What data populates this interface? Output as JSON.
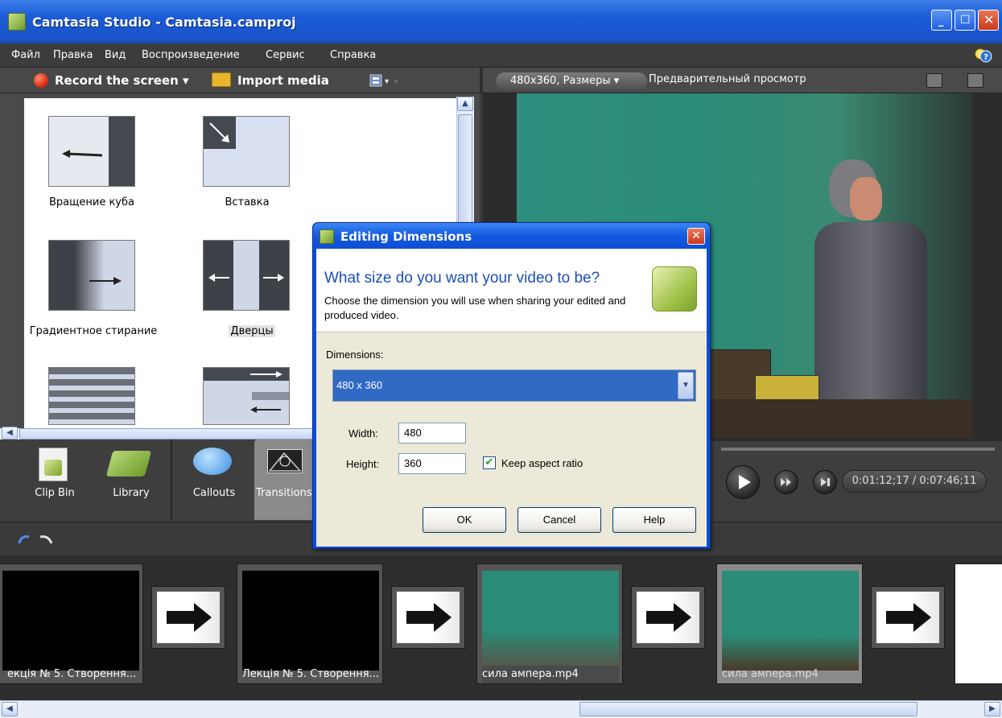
{
  "window": {
    "title": "Camtasia Studio - Camtasia.camproj"
  },
  "menu": [
    "Файл",
    "Правка",
    "Вид",
    "Воспроизведение",
    "Сервис",
    "Справка"
  ],
  "toolbar": {
    "record_label": "Record the screen",
    "import_label": "Import media"
  },
  "transitions": [
    {
      "label": "Вращение куба"
    },
    {
      "label": "Вставка"
    },
    {
      "label": "Градиентное стирание"
    },
    {
      "label": "Дверцы"
    }
  ],
  "tabs": [
    "Clip Bin",
    "Library",
    "Callouts",
    "Transitions"
  ],
  "preview": {
    "size_label": "480x360, Размеры",
    "title": "Предварительный просмотр",
    "time": "0:01:12;17 / 0:07:46;11"
  },
  "storyboard": [
    {
      "caption": "екція № 5. Створення..."
    },
    {
      "caption": "Лекція № 5. Створення..."
    },
    {
      "caption": "сила ампера.mp4"
    },
    {
      "caption": "сила ампера.mp4"
    }
  ],
  "dialog": {
    "title": "Editing Dimensions",
    "question": "What size do you want your video to be?",
    "description": "Choose the dimension you will use when sharing your edited and produced video.",
    "dimensions_label": "Dimensions:",
    "dimensions_value": "480 x 360",
    "width_label": "Width:",
    "width_value": "480",
    "height_label": "Height:",
    "height_value": "360",
    "keep_aspect_label": "Keep aspect ratio",
    "keep_aspect_checked": true,
    "ok": "OK",
    "cancel": "Cancel",
    "help": "Help"
  },
  "colors": {
    "titlebar": "#1b5bd8",
    "dialog_selection": "#316ac5",
    "panel": "#3e3e3e"
  }
}
